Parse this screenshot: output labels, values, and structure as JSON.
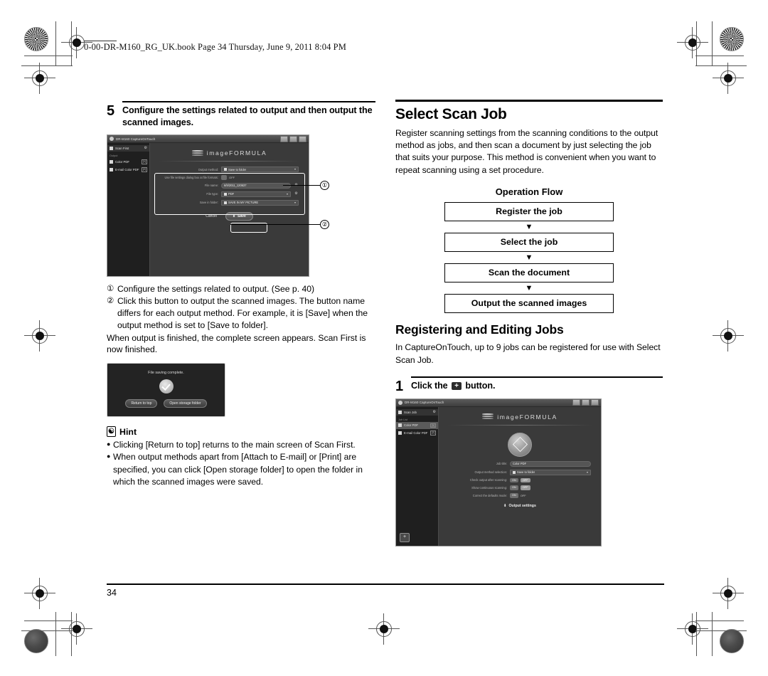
{
  "page": {
    "header_line": "0-00-DR-M160_RG_UK.book  Page 34  Thursday, June 9, 2011  8:04 PM",
    "page_number": "34"
  },
  "left_column": {
    "step": {
      "number": "5",
      "title": "Configure the settings related to output and then output the scanned images."
    },
    "callouts": [
      {
        "mark": "①",
        "text": "Configure the settings related to output. (See p. 40)"
      },
      {
        "mark": "②",
        "text": "Click this button to output the scanned images. The button name differs for each output method. For example, it is [Save] when the output method is set to [Save to folder]."
      }
    ],
    "after_text": "When output is finished, the complete screen appears. Scan First is now finished.",
    "hint": {
      "icon": "lightbulb-icon",
      "label": "Hint",
      "items": [
        "Clicking [Return to top] returns to the main screen of Scan First.",
        "When output methods apart from [Attach to E-mail] or [Print] are specified, you can click [Open storage folder] to open the folder in which the scanned images were saved."
      ]
    },
    "screenshot_output": {
      "window_title": "DR-M160 CaptureOnTouch",
      "logo": "imageFORMULA",
      "sidebar": {
        "header": "Scan First",
        "group_label": "Output",
        "items": [
          {
            "label": "Color PDF",
            "badge": "[1]"
          },
          {
            "label": "E-mail Color PDF",
            "badge": "[2]"
          }
        ]
      },
      "settings": [
        {
          "label": "Output method:",
          "value": "Save to folder",
          "type": "select"
        },
        {
          "label": "Use file settings dialog box at file formats:",
          "value": "OFF",
          "type": "toggle"
        },
        {
          "label": "File name:",
          "value": "6/9/2011_120637",
          "type": "text"
        },
        {
          "label": "File type:",
          "value": "PDF",
          "type": "select"
        },
        {
          "label": "Save in folder:",
          "value": "SAVE IN MY PICTURE",
          "type": "select"
        }
      ],
      "buttons": {
        "cancel": "Cancel",
        "save": "Save"
      },
      "callout_labels": [
        "①",
        "②"
      ]
    },
    "screenshot_complete": {
      "message": "File saving complete.",
      "buttons": [
        "Return to top",
        "Open storage folder"
      ]
    }
  },
  "right_column": {
    "section_title": "Select Scan Job",
    "section_body": "Register scanning settings from the scanning conditions to the output method as jobs, and then scan a document by just selecting the job that suits your purpose. This method is convenient when you want to repeat scanning using a set procedure.",
    "operation_flow": {
      "title": "Operation Flow",
      "steps": [
        "Register the job",
        "Select the job",
        "Scan the document",
        "Output the scanned images"
      ],
      "arrow": "▼"
    },
    "subsection_title": "Registering and Editing Jobs",
    "subsection_body": "In CaptureOnTouch, up to 9 jobs can be registered for use with Select Scan Job.",
    "step": {
      "number": "1",
      "title_before": "Click the",
      "button_glyph": "+",
      "title_after": "button."
    },
    "screenshot_job": {
      "window_title": "DR-M160 CaptureOnTouch",
      "logo": "imageFORMULA",
      "sidebar": {
        "header": "Scan Job",
        "group_label": "Job List",
        "items": [
          {
            "label": "Color PDF",
            "badge": "[1]"
          },
          {
            "label": "E-mail Color PDF",
            "badge": "[2]"
          }
        ]
      },
      "settings": [
        {
          "label": "Job title:",
          "value": "Color PDF",
          "type": "text"
        },
        {
          "label": "Output method selection:",
          "value": "Save to folder",
          "type": "select"
        },
        {
          "label": "Check output after scanning:",
          "value": "OFF",
          "type": "toggle",
          "on_label": "ON",
          "off_label": "OFF"
        },
        {
          "label": "Show continuous scanning:",
          "value": "OFF",
          "type": "toggle",
          "on_label": "ON",
          "off_label": "OFF"
        },
        {
          "label": "Correct the defaults mode:",
          "value": "OFF",
          "type": "toggle",
          "on_label": "ON",
          "off_label": "OFF"
        }
      ],
      "output_settings_label": "Output settings",
      "add_button_glyph": "+"
    }
  }
}
